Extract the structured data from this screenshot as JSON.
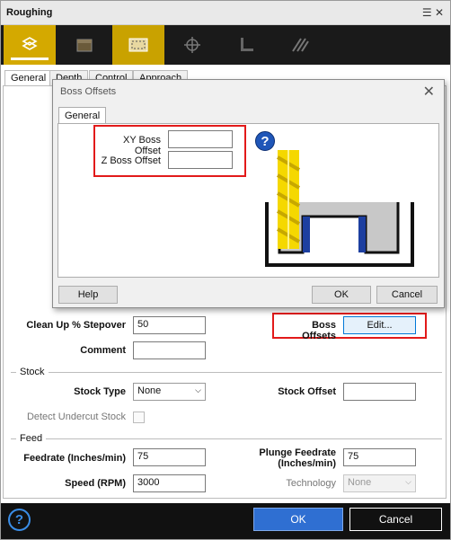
{
  "window": {
    "title": "Roughing"
  },
  "toolbar": {
    "items": [
      {
        "icon": "roughing-icon",
        "active": true
      },
      {
        "icon": "depth-block-icon"
      },
      {
        "icon": "boundary-icon",
        "active": true
      },
      {
        "icon": "target-icon"
      },
      {
        "icon": "corner-icon"
      },
      {
        "icon": "pattern-icon"
      }
    ]
  },
  "tabs": [
    "General",
    "Depth",
    "Control",
    "Approach"
  ],
  "form": {
    "cleanup_label": "Clean Up % Stepover",
    "cleanup_value": "50",
    "boss_label": "Boss Offsets",
    "boss_button": "Edit...",
    "comment_label": "Comment",
    "comment_value": "",
    "stock_section": "Stock",
    "stock_type_label": "Stock Type",
    "stock_type_value": "None",
    "stock_offset_label": "Stock Offset",
    "stock_offset_value": "",
    "undercut_label": "Detect Undercut Stock",
    "feed_section": "Feed",
    "feedrate_label": "Feedrate (Inches/min)",
    "feedrate_value": "75",
    "plunge_label_1": "Plunge Feedrate",
    "plunge_label_2": "(Inches/min)",
    "plunge_value": "75",
    "speed_label": "Speed (RPM)",
    "speed_value": "3000",
    "technology_label": "Technology",
    "technology_value": "None"
  },
  "footer": {
    "ok": "OK",
    "cancel": "Cancel",
    "help_glyph": "?"
  },
  "modal": {
    "title": "Boss Offsets",
    "close": "✕",
    "tab": "General",
    "xy_label": "XY Boss Offset",
    "xy_value": "",
    "z_label": "Z Boss Offset",
    "z_value": "",
    "help_glyph": "?",
    "help_button": "Help",
    "ok_button": "OK",
    "cancel_button": "Cancel"
  },
  "colors": {
    "accent_yellow": "#d4a900",
    "highlight_red": "#e21a1a",
    "ok_blue": "#2f6fd2"
  }
}
